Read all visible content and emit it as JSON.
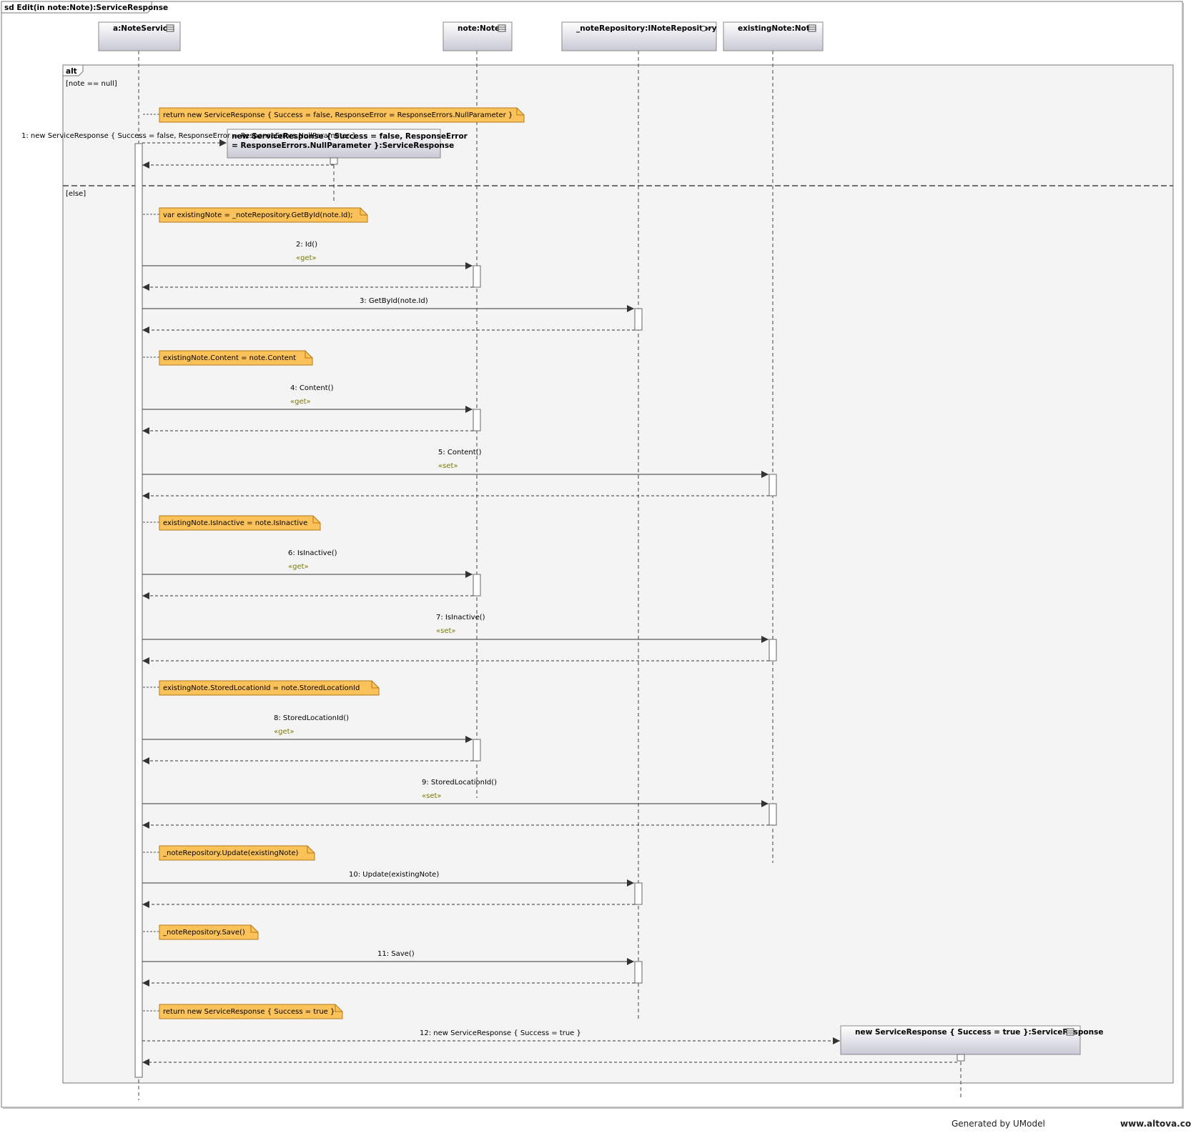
{
  "diagram_title": "sd Edit(in note:Note):ServiceResponse",
  "lifelines": [
    {
      "id": "svc",
      "label": "a:NoteService",
      "icon": "class-icon"
    },
    {
      "id": "note",
      "label": "note:Note",
      "icon": "class-icon"
    },
    {
      "id": "repo",
      "label": "_noteRepository:INoteRepository",
      "icon": "interface-lollipop-icon"
    },
    {
      "id": "existing",
      "label": "existingNote:Note",
      "icon": "class-icon"
    }
  ],
  "fragment": {
    "operator": "alt",
    "guards": [
      "[note == null]",
      "[else]"
    ]
  },
  "notes": [
    "return new ServiceResponse { Success = false, ResponseError = ResponseErrors.NullParameter }",
    "var existingNote = _noteRepository.GetById(note.Id);",
    "existingNote.Content = note.Content",
    "existingNote.IsInactive = note.IsInactive",
    "existingNote.StoredLocationId = note.StoredLocationId",
    "_noteRepository.Update(existingNote)",
    "_noteRepository.Save()",
    "return new ServiceResponse { Success = true }"
  ],
  "created_objects": [
    {
      "line1": "new ServiceResponse { Success = false, ResponseError",
      "line2": "= ResponseErrors.NullParameter }:ServiceResponse"
    },
    {
      "line1": "new ServiceResponse { Success = true }:ServiceResponse",
      "line2": ""
    }
  ],
  "messages": [
    {
      "label": "1: new ServiceResponse { Success = false, ResponseError = ResponseErrors.NullParameter }",
      "stereo": ""
    },
    {
      "label": "2: Id()",
      "stereo": "«get»"
    },
    {
      "label": "3: GetById(note.Id)",
      "stereo": ""
    },
    {
      "label": "4: Content()",
      "stereo": "«get»"
    },
    {
      "label": "5: Content()",
      "stereo": "«set»"
    },
    {
      "label": "6: IsInactive()",
      "stereo": "«get»"
    },
    {
      "label": "7: IsInactive()",
      "stereo": "«set»"
    },
    {
      "label": "8: StoredLocationId()",
      "stereo": "«get»"
    },
    {
      "label": "9: StoredLocationId()",
      "stereo": "«set»"
    },
    {
      "label": "10: Update(existingNote)",
      "stereo": ""
    },
    {
      "label": "11: Save()",
      "stereo": ""
    },
    {
      "label": "12: new ServiceResponse { Success = true }",
      "stereo": ""
    }
  ],
  "footer": {
    "generated_by": "Generated by UModel",
    "site": "www.altova.com"
  },
  "colors": {
    "note_fill": "#fcc25a",
    "note_stroke": "#b27a1a",
    "stereotype": "#7a7a00",
    "fragment_fill": "#f4f4f4",
    "lifeline_head_top": "#ffffff",
    "lifeline_head_bottom": "#c9c9d6"
  }
}
